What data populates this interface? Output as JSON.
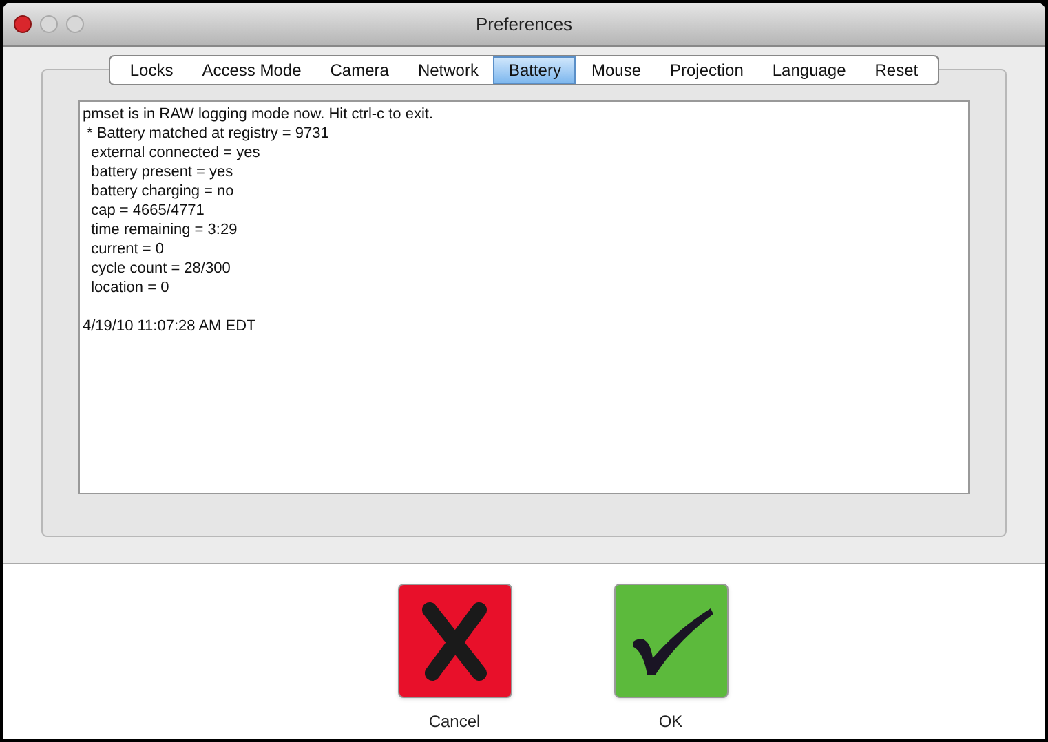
{
  "window": {
    "title": "Preferences"
  },
  "tabs": [
    {
      "label": "Locks",
      "selected": false
    },
    {
      "label": "Access Mode",
      "selected": false
    },
    {
      "label": "Camera",
      "selected": false
    },
    {
      "label": "Network",
      "selected": false
    },
    {
      "label": "Battery",
      "selected": true
    },
    {
      "label": "Mouse",
      "selected": false
    },
    {
      "label": "Projection",
      "selected": false
    },
    {
      "label": "Language",
      "selected": false
    },
    {
      "label": "Reset",
      "selected": false
    }
  ],
  "log_lines": [
    "pmset is in RAW logging mode now. Hit ctrl-c to exit.",
    " * Battery matched at registry = 9731",
    "  external connected = yes",
    "  battery present = yes",
    "  battery charging = no",
    "  cap = 4665/4771",
    "  time remaining = 3:29",
    "  current = 0",
    "  cycle count = 28/300",
    "  location = 0"
  ],
  "timestamp": "4/19/10 11:07:28 AM EDT",
  "buttons": [
    {
      "kind": "cancel",
      "label": "Cancel"
    },
    {
      "kind": "ok",
      "label": "OK"
    }
  ]
}
